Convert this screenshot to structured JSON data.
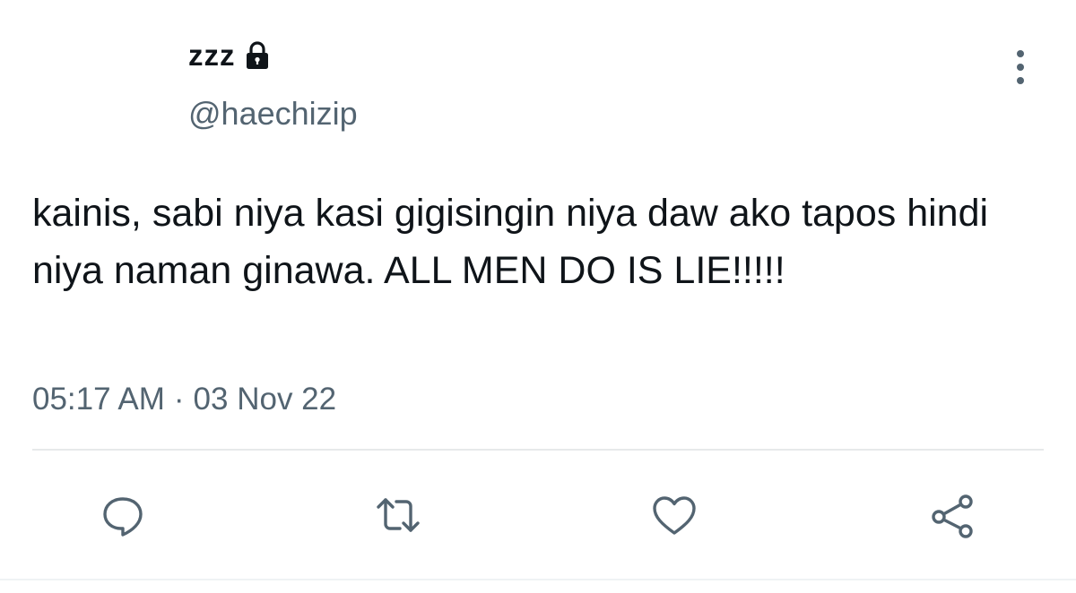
{
  "author": {
    "display_name": "zzz",
    "handle": "@haechizip",
    "protected_icon": "lock-icon"
  },
  "tweet": {
    "text": "kainis, sabi niya kasi gigisingin niya daw ako tapos hindi niya naman ginawa. ALL MEN DO IS LIE!!!!!",
    "time": "05:17 AM",
    "separator": "·",
    "date": "03 Nov 22"
  },
  "actions": {
    "reply_icon": "speech-bubble-icon",
    "retweet_icon": "retweet-icon",
    "like_icon": "heart-icon",
    "share_icon": "share-icon",
    "more_icon": "more-vertical-icon"
  },
  "colors": {
    "text": "#0f1419",
    "secondary": "#536471",
    "divider": "#e7e9ea"
  }
}
